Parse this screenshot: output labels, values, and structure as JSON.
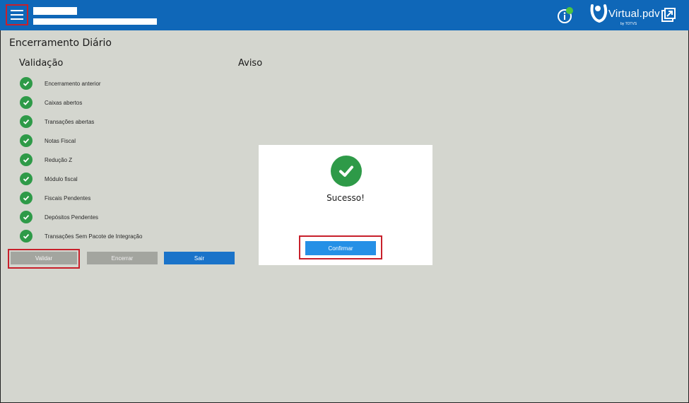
{
  "header": {
    "brand": "Virtual.pdv",
    "brand_sub": "by TOTVS",
    "accent_color": "#0f67b8"
  },
  "page": {
    "title": "Encerramento Diário",
    "validation_heading": "Validação",
    "notice_heading": "Aviso"
  },
  "checks": [
    {
      "label": "Encerramento anterior",
      "status": "ok"
    },
    {
      "label": "Caixas abertos",
      "status": "ok"
    },
    {
      "label": "Transações abertas",
      "status": "ok"
    },
    {
      "label": "Notas Fiscal",
      "status": "ok"
    },
    {
      "label": "Redução Z",
      "status": "ok"
    },
    {
      "label": "Módulo fiscal",
      "status": "ok"
    },
    {
      "label": "Fiscais Pendentes",
      "status": "ok"
    },
    {
      "label": "Depósitos Pendentes",
      "status": "ok"
    },
    {
      "label": "Transações Sem Pacote de Integração",
      "status": "ok"
    }
  ],
  "actions": {
    "validate_label": "Validar",
    "close_label": "Encerrar",
    "exit_label": "Sair"
  },
  "dialog": {
    "message": "Sucesso!",
    "confirm_label": "Confirmar",
    "success_color": "#2e9a48"
  },
  "icons": [
    "menu-icon",
    "info-icon",
    "virtual-pdv-logo-icon",
    "exit-icon",
    "check-circle-icon"
  ]
}
